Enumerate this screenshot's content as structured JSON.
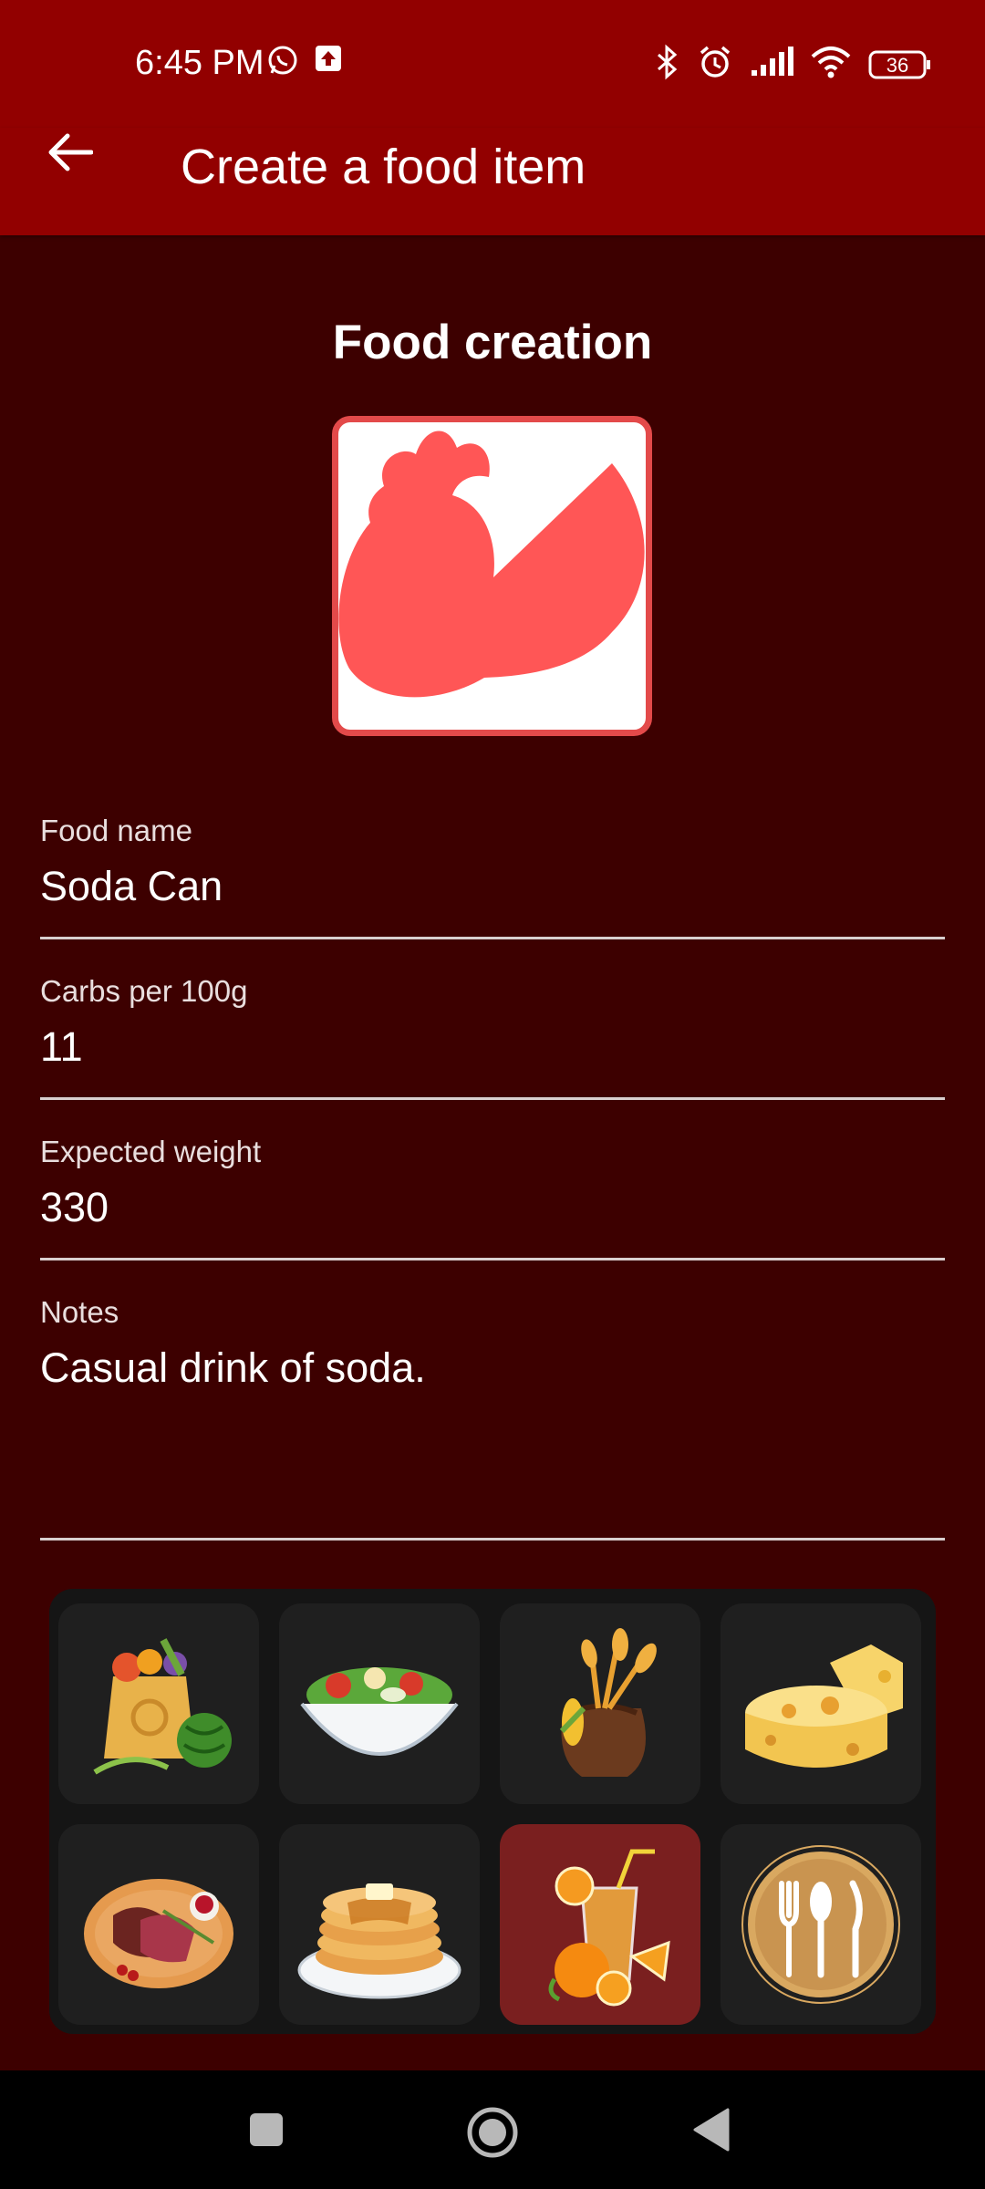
{
  "status_bar": {
    "time": "6:45 PM",
    "battery": "36",
    "left_icons": [
      "whatsapp-icon",
      "upload-icon"
    ],
    "right_icons": [
      "bluetooth-icon",
      "alarm-icon",
      "signal-icon",
      "wifi-icon",
      "battery-icon"
    ]
  },
  "app_bar": {
    "title": "Create a food item",
    "back_icon": "arrow-back-icon"
  },
  "main": {
    "section_title": "Food creation",
    "fields": {
      "food_name": {
        "label": "Food name",
        "value": "Soda Can"
      },
      "carbs": {
        "label": "Carbs per 100g",
        "value": "11"
      },
      "weight": {
        "label": "Expected weight",
        "value": "330"
      },
      "notes": {
        "label": "Notes",
        "value": "Casual drink of soda."
      }
    }
  },
  "icon_picker": {
    "items": [
      {
        "name": "grocery-bag-icon",
        "selected": false
      },
      {
        "name": "salad-bowl-icon",
        "selected": false
      },
      {
        "name": "wheat-sack-icon",
        "selected": false
      },
      {
        "name": "cheese-icon",
        "selected": false
      },
      {
        "name": "roast-meat-icon",
        "selected": false
      },
      {
        "name": "pancakes-icon",
        "selected": false
      },
      {
        "name": "juice-drink-icon",
        "selected": true
      },
      {
        "name": "cutlery-plate-icon",
        "selected": false
      }
    ]
  },
  "nav_bar": {
    "icons": [
      "recents-square-icon",
      "home-circle-icon",
      "back-triangle-icon"
    ]
  },
  "colors": {
    "status_bar": "#920000",
    "background": "#3d0000",
    "accent": "#e34a4a",
    "selected_tile": "#7a1f1f"
  }
}
